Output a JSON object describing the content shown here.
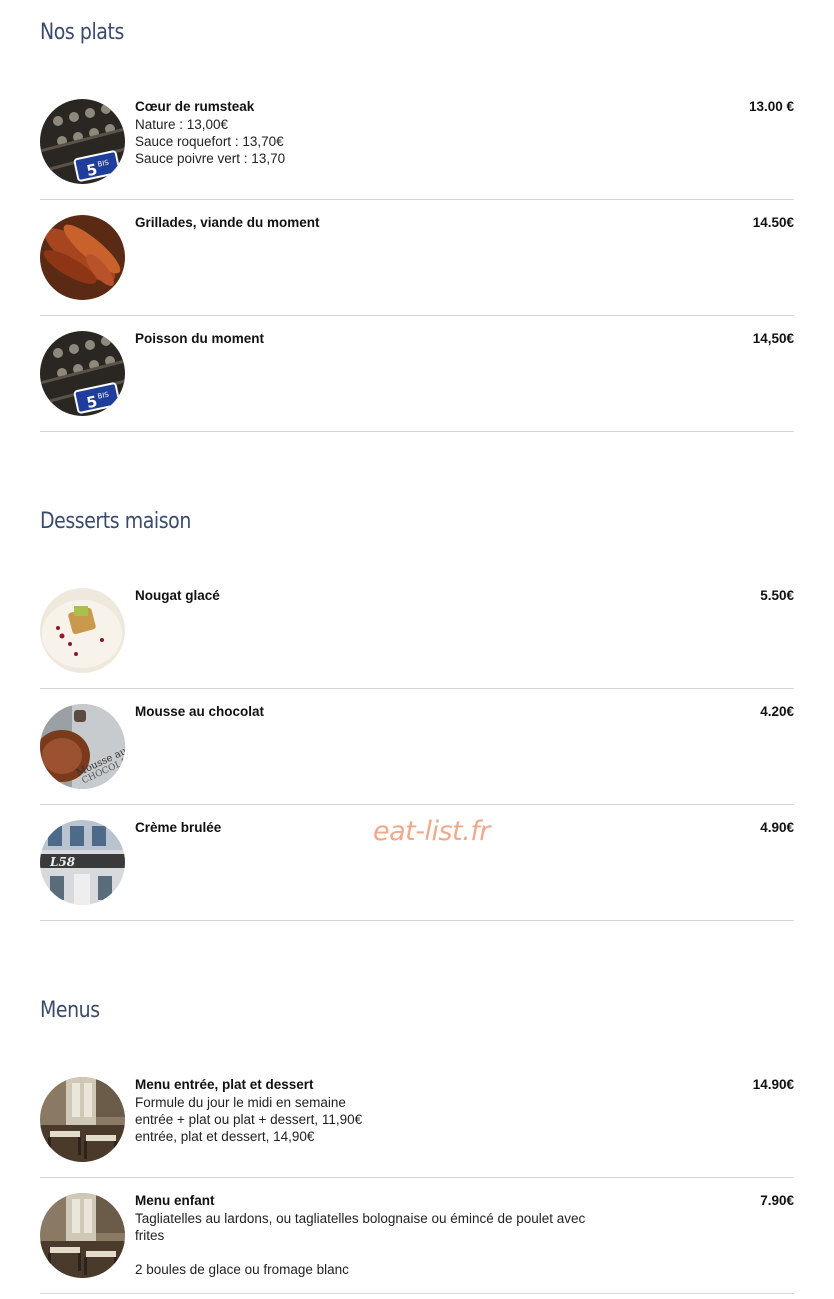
{
  "sections": [
    {
      "title": "Nos plats",
      "items": [
        {
          "name": "Cœur de rumsteak",
          "price": "13.00 €",
          "image": "wine-rack-5bis",
          "desc": [
            "Nature : 13,00€",
            "Sauce roquefort : 13,70€",
            "Sauce poivre vert : 13,70"
          ]
        },
        {
          "name": "Grillades, viande du moment",
          "price": "14.50€",
          "image": "grilled-meat",
          "desc": []
        },
        {
          "name": "Poisson du moment",
          "price": "14,50€",
          "image": "wine-rack-5bis",
          "desc": []
        }
      ]
    },
    {
      "title": "Desserts maison",
      "items": [
        {
          "name": "Nougat glacé",
          "price": "5.50€",
          "image": "nougat-plate",
          "desc": []
        },
        {
          "name": "Mousse au chocolat",
          "price": "4.20€",
          "image": "chocolate-mousse",
          "desc": []
        },
        {
          "name": "Crème brulée",
          "price": "4.90€",
          "image": "restaurant-facade",
          "desc": []
        }
      ]
    },
    {
      "title": "Menus",
      "items": [
        {
          "name": "Menu entrée, plat et dessert",
          "price": "14.90€",
          "image": "dining-room",
          "desc": [
            "Formule du jour le midi en semaine",
            "entrée + plat ou plat + dessert, 11,90€",
            "entrée, plat et dessert, 14,90€"
          ]
        },
        {
          "name": "Menu enfant",
          "price": "7.90€",
          "image": "dining-room",
          "desc": [
            "Tagliatelles au lardons, ou tagliatelles bolognaise ou émincé de poulet avec frites",
            "",
            "2 boules de glace ou fromage blanc"
          ]
        }
      ]
    }
  ],
  "watermark": "eat-list.fr",
  "colors": {
    "heading": "#3b4a6b",
    "watermark": "#f0a98a",
    "divider": "#d6d6d6"
  }
}
